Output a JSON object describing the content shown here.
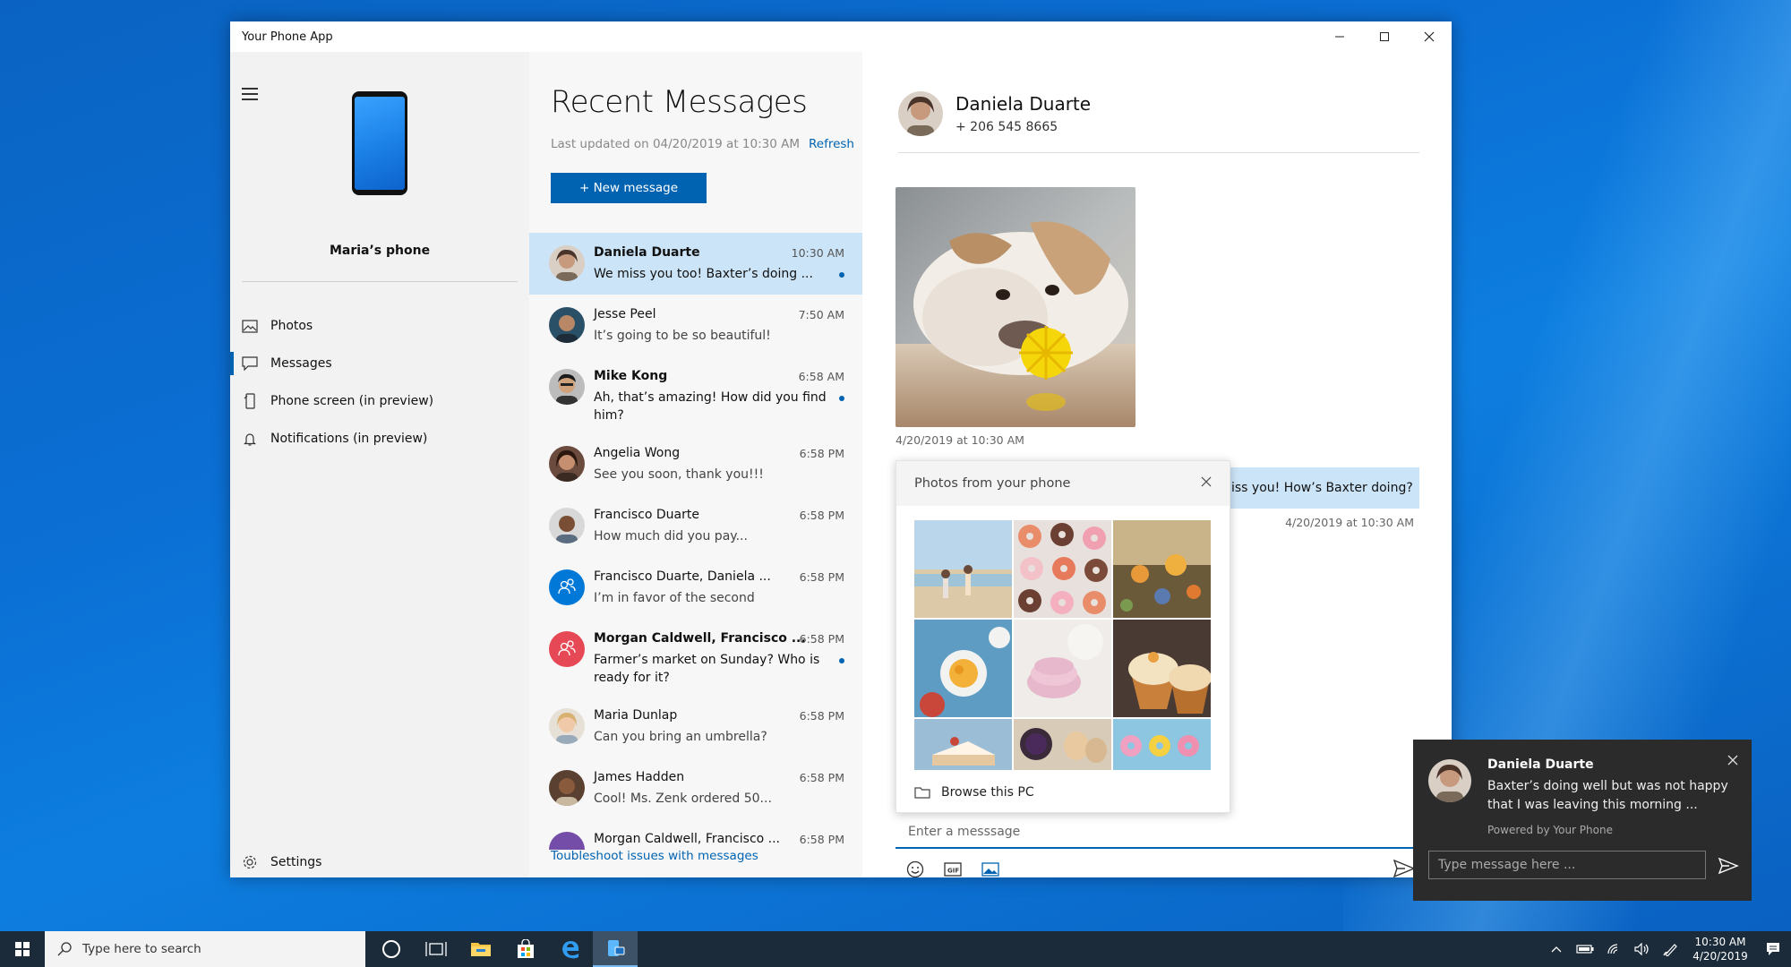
{
  "window": {
    "title": "Your Phone App",
    "controls": [
      "minimize",
      "maximize",
      "close"
    ]
  },
  "nav": {
    "phone_name": "Maria’s phone",
    "items": [
      {
        "label": "Photos",
        "icon": "photos-icon"
      },
      {
        "label": "Messages",
        "icon": "messages-icon",
        "active": true
      },
      {
        "label": "Phone screen (in preview)",
        "icon": "phone-screen-icon"
      },
      {
        "label": "Notifications (in preview)",
        "icon": "bell-icon"
      }
    ],
    "settings_label": "Settings"
  },
  "list": {
    "title": "Recent Messages",
    "last_updated": "Last updated on 04/20/2019 at 10:30 AM",
    "refresh_label": "Refresh",
    "new_message_label": "+ New message",
    "troubleshoot_label": "Toubleshoot issues with messages",
    "conversations": [
      {
        "name": "Daniela Duarte",
        "time": "10:30 AM",
        "preview": "We miss you too! Baxter’s doing ...",
        "unread": true,
        "selected": true
      },
      {
        "name": "Jesse Peel",
        "time": "7:50 AM",
        "preview": "It’s going to be so beautiful!",
        "unread": false
      },
      {
        "name": "Mike Kong",
        "time": "6:58 AM",
        "preview": "Ah, that’s amazing! How did you find him?",
        "unread": true
      },
      {
        "name": "Angelia Wong",
        "time": "6:58 PM",
        "preview": "See you soon, thank you!!!",
        "unread": false
      },
      {
        "name": "Francisco Duarte",
        "time": "6:58 PM",
        "preview": "How much did you pay...",
        "unread": false
      },
      {
        "name": "Francisco Duarte, Daniela ...",
        "time": "6:58 PM",
        "preview": "I’m in favor of the second",
        "unread": false
      },
      {
        "name": "Morgan Caldwell, Francisco ...",
        "time": "6:58 PM",
        "preview": "Farmer’s market on Sunday? Who is ready for it?",
        "unread": true
      },
      {
        "name": "Maria Dunlap",
        "time": "6:58 PM",
        "preview": "Can you bring an umbrella?",
        "unread": false
      },
      {
        "name": "James Hadden",
        "time": "6:58 PM",
        "preview": "Cool! Ms. Zenk ordered 50...",
        "unread": false
      },
      {
        "name": "Morgan Caldwell, Francisco ...",
        "time": "6:58 PM",
        "preview": "",
        "unread": false
      }
    ]
  },
  "conversation": {
    "name": "Daniela Duarte",
    "phone": "+ 206 545 8665",
    "photo_timestamp": "4/20/2019 at 10:30 AM",
    "sent_message": "iss you! How’s Baxter doing?",
    "sent_timestamp": "4/20/2019 at 10:30 AM",
    "composer_placeholder": "Enter a messsage"
  },
  "photos_popup": {
    "title": "Photos from your phone",
    "browse_label": "Browse this PC"
  },
  "toast": {
    "name": "Daniela Duarte",
    "message": "Baxter’s doing well but was not happy that I was leaving this morning ...",
    "powered_by": "Powered by Your Phone",
    "input_placeholder": "Type message here ..."
  },
  "taskbar": {
    "search_placeholder": "Type here to search",
    "time": "10:30 AM",
    "date": "4/20/2019"
  },
  "colors": {
    "accent": "#0063b1",
    "selected_row": "#cce4f7",
    "taskbar": "#1c2b3a"
  }
}
